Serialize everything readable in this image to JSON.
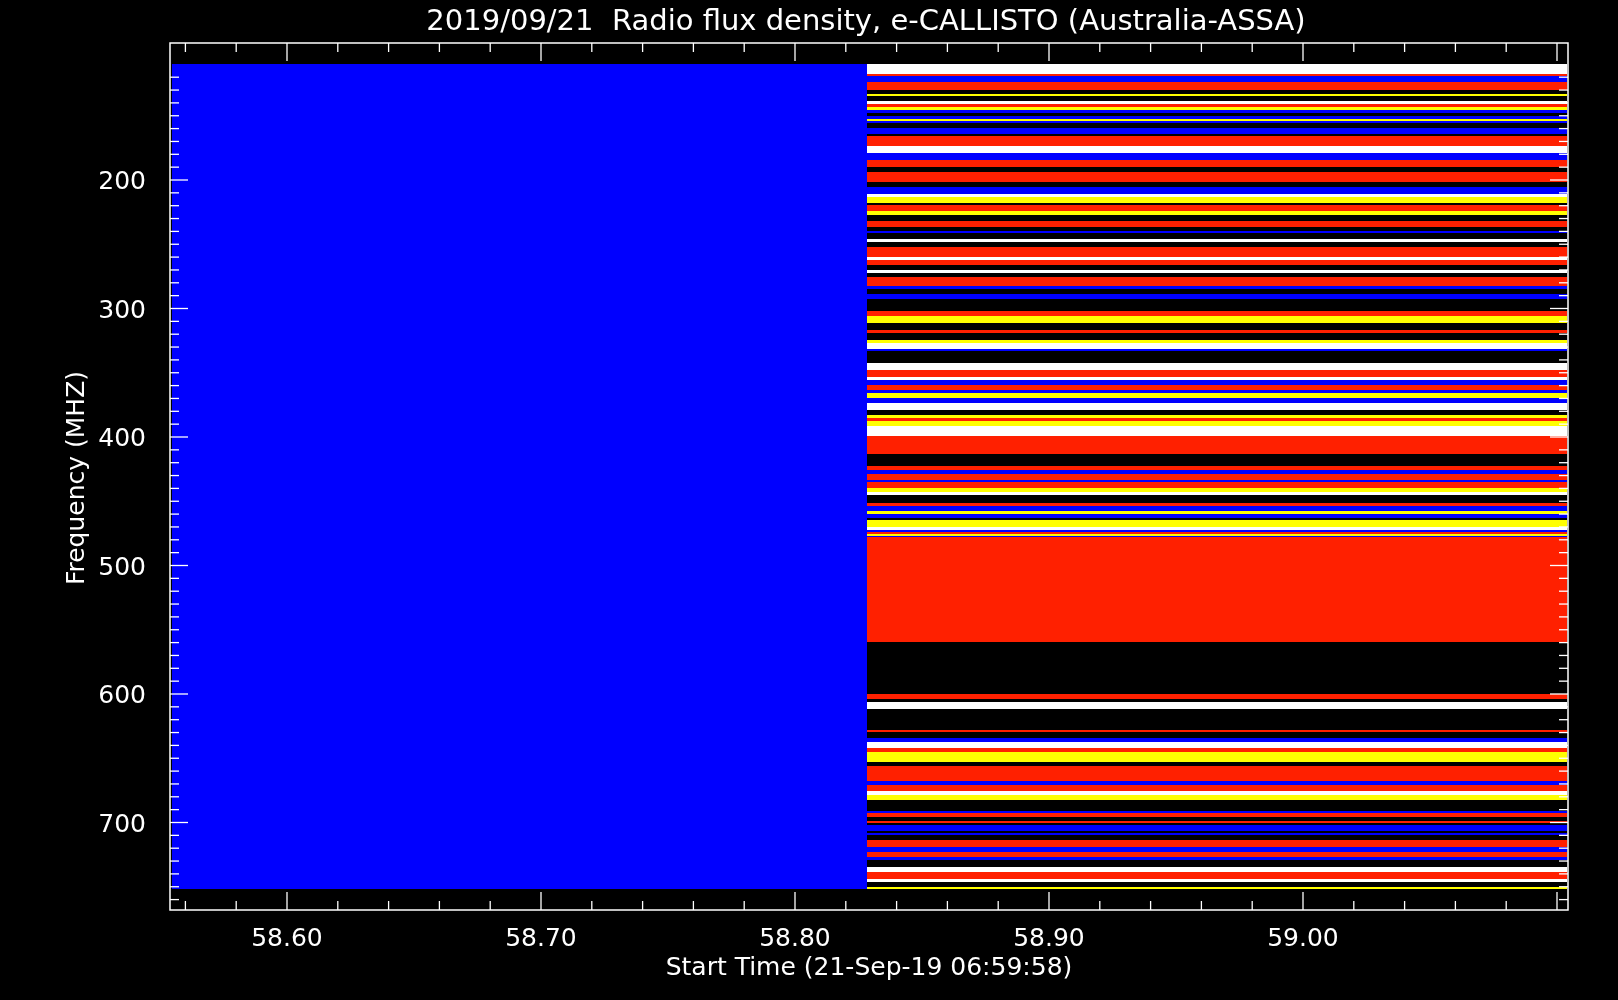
{
  "title": "2019/09/21  Radio flux density, e-CALLISTO (Australia-ASSA)",
  "x_axis": {
    "label": "Start Time (21-Sep-19 06:59:58)",
    "ticks": [
      "58.60",
      "58.70",
      "58.80",
      "58.90",
      "59.00"
    ]
  },
  "y_axis": {
    "label": "Frequency (MHZ)",
    "ticks": [
      "200",
      "300",
      "400",
      "500",
      "600",
      "700"
    ]
  }
}
